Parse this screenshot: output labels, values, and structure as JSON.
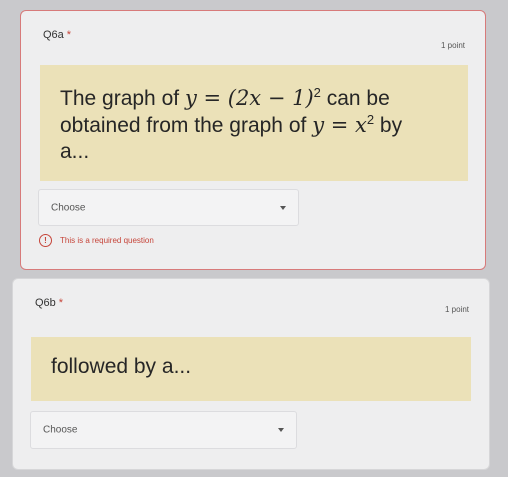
{
  "q6a": {
    "title": "Q6a",
    "required_marker": "*",
    "points": "1 point",
    "prompt": {
      "line1_prefix": "The graph of",
      "line1_math": "y = (2x − 1)",
      "line1_exp": "2",
      "line1_suffix": "can be",
      "line2_prefix": "obtained from the graph of",
      "line2_math": "y = x",
      "line2_exp": "2",
      "line2_suffix": "by",
      "line3": "a..."
    },
    "select_label": "Choose",
    "error": "This is a required question",
    "error_icon": "!"
  },
  "q6b": {
    "title": "Q6b",
    "required_marker": "*",
    "points": "1 point",
    "prompt": "followed by a...",
    "select_label": "Choose"
  },
  "colors": {
    "prompt_bg": "#ebe1b8",
    "error": "#c6453a",
    "card_bg": "#eeeeef",
    "page_bg": "#c9c9cc"
  }
}
